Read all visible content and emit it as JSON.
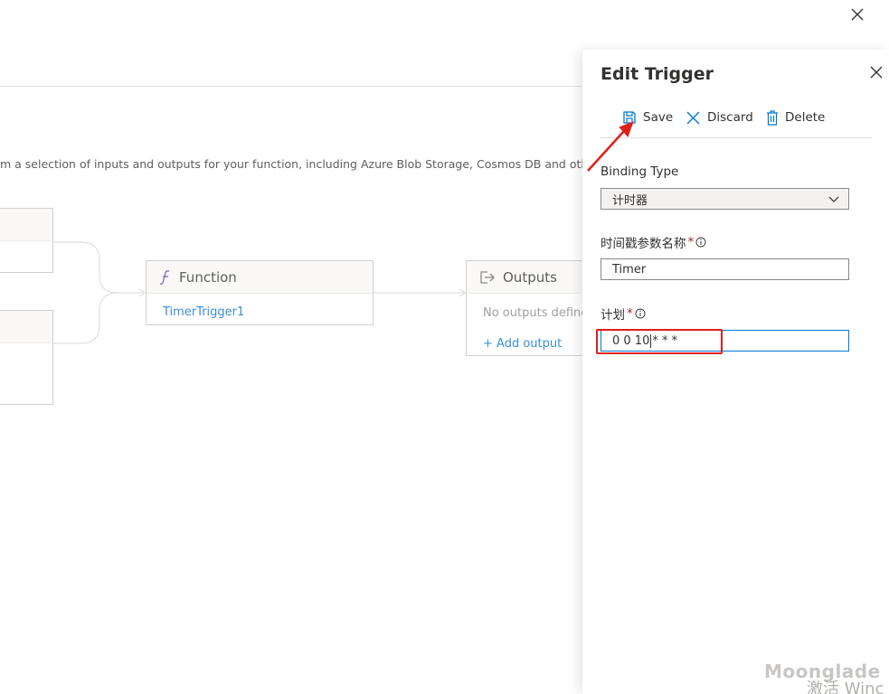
{
  "designer": {
    "description": "m a selection of inputs and outputs for your function, including Azure Blob Storage, Cosmos DB and othe",
    "function_card": {
      "title": "Function",
      "trigger_link": "TimerTrigger1"
    },
    "outputs_card": {
      "title": "Outputs",
      "empty_text": "No outputs define",
      "add_link": "+ Add output"
    }
  },
  "panel": {
    "title": "Edit Trigger",
    "commands": {
      "save": "Save",
      "discard": "Discard",
      "delete": "Delete"
    },
    "binding_type": {
      "label": "Binding Type",
      "value": "计时器"
    },
    "timestamp_param": {
      "label": "时间戳参数名称",
      "value": "Timer"
    },
    "schedule": {
      "label": "计划",
      "value_before_caret": "0 0 10",
      "value_after_caret": "* * *"
    }
  },
  "overlay": {
    "watermark": "Moonglade",
    "activation_text": "激活 Winc"
  },
  "colors": {
    "accent": "#0078d4",
    "link": "#3a8fd8",
    "required": "#a4262c",
    "annotation_red": "#e0201a"
  },
  "icons": [
    "close-icon",
    "save-icon",
    "discard-icon",
    "delete-icon",
    "function-icon",
    "outputs-icon",
    "chevron-down-icon",
    "info-icon"
  ]
}
